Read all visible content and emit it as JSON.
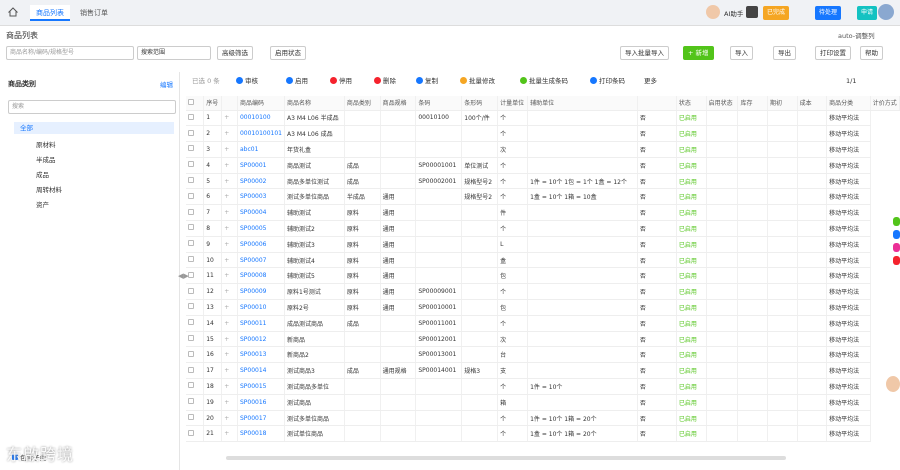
{
  "topbar": {
    "tabs": [
      "商品列表",
      "销售订单"
    ],
    "user_label": "AI助手",
    "buttons": [
      "已完成",
      "待处理",
      "申请"
    ],
    "colors": {
      "orange": "#f5a623",
      "blue": "#1677ff",
      "teal": "#13c2c2"
    }
  },
  "page": {
    "title": "商品列表",
    "right_hint": "auto-调整列"
  },
  "toolbar1": {
    "search_placeholder": "商品名称/编码/规格型号",
    "search_scope": "搜索范围",
    "filter_label": "高级筛选",
    "quick_filter": "启用状态",
    "import_label": "导入批量导入",
    "new_label": "+ 新增",
    "btn_in": "导入",
    "btn_out": "导出",
    "btn_print": "打印设置",
    "btn_more": "帮助"
  },
  "sidebar": {
    "title": "商品类别",
    "manage": "编辑",
    "search_placeholder": "搜索",
    "tree": [
      {
        "label": "全部",
        "active": true
      },
      {
        "label": "原材料"
      },
      {
        "label": "半成品"
      },
      {
        "label": "成品"
      },
      {
        "label": "周转材料"
      },
      {
        "label": "资产"
      }
    ],
    "footer_checkbox": "包含子类"
  },
  "toolbar2": {
    "selected": "已选 0 条",
    "items": [
      "审核",
      "启用",
      "停用",
      "删除",
      "复制",
      "批量修改",
      "批量生成条码",
      "打印条码",
      "更多"
    ],
    "pager": "1/1"
  },
  "table": {
    "headers": [
      "",
      "序号",
      "",
      "商品编码",
      "商品名称",
      "商品类别",
      "商品规格",
      "条码",
      "条形码",
      "计量单位",
      "辅助单位",
      "",
      "状态",
      "启用状态",
      "库存",
      "期初",
      "成本",
      "商品分类",
      "计价方式"
    ],
    "rows": [
      [
        "1",
        "00010100",
        "A3 M4 L06 半成品",
        "",
        "",
        "00010100",
        "100个/件",
        "个",
        "",
        "否",
        "已启用",
        "",
        "",
        "",
        "",
        "移动平均法"
      ],
      [
        "2",
        "00010100101",
        "A3 M4 L06 成品",
        "",
        "",
        "",
        "",
        "个",
        "",
        "否",
        "已启用",
        "",
        "",
        "",
        "",
        "移动平均法"
      ],
      [
        "3",
        "abc01",
        "年货礼盒",
        "",
        "",
        "",
        "",
        "次",
        "",
        "否",
        "已启用",
        "",
        "",
        "",
        "",
        "移动平均法"
      ],
      [
        "4",
        "SP00001",
        "商品测试",
        "成品",
        "",
        "SP00001001",
        "单位测试",
        "个",
        "",
        "否",
        "已启用",
        "",
        "",
        "",
        "",
        "移动平均法"
      ],
      [
        "5",
        "SP00002",
        "商品多单位测试",
        "成品",
        "",
        "SP00002001",
        "规格型号2",
        "个",
        "1件 = 10个 1包 = 1个 1盒 = 12个",
        "否",
        "已启用",
        "",
        "",
        "",
        "",
        "移动平均法"
      ],
      [
        "6",
        "SP00003",
        "测试多单位商品",
        "半成品",
        "通用",
        "",
        "规格型号2",
        "个",
        "1盒 = 10个 1箱 = 10盒",
        "否",
        "已启用",
        "",
        "",
        "",
        "",
        "移动平均法"
      ],
      [
        "7",
        "SP00004",
        "辅助测试",
        "原料",
        "通用",
        "",
        "",
        "件",
        "",
        "否",
        "已启用",
        "",
        "",
        "",
        "",
        "移动平均法"
      ],
      [
        "8",
        "SP00005",
        "辅助测试2",
        "原料",
        "通用",
        "",
        "",
        "个",
        "",
        "否",
        "已启用",
        "",
        "",
        "",
        "",
        "移动平均法"
      ],
      [
        "9",
        "SP00006",
        "辅助测试3",
        "原料",
        "通用",
        "",
        "",
        "L",
        "",
        "否",
        "已启用",
        "",
        "",
        "",
        "",
        "移动平均法"
      ],
      [
        "10",
        "SP00007",
        "辅助测试4",
        "原料",
        "通用",
        "",
        "",
        "盒",
        "",
        "否",
        "已启用",
        "",
        "",
        "",
        "",
        "移动平均法"
      ],
      [
        "11",
        "SP00008",
        "辅助测试5",
        "原料",
        "通用",
        "",
        "",
        "包",
        "",
        "否",
        "已启用",
        "",
        "",
        "",
        "",
        "移动平均法"
      ],
      [
        "12",
        "SP00009",
        "原料1号测试",
        "原料",
        "通用",
        "SP00009001",
        "",
        "个",
        "",
        "否",
        "已启用",
        "",
        "",
        "",
        "",
        "移动平均法"
      ],
      [
        "13",
        "SP00010",
        "原料2号",
        "原料",
        "通用",
        "SP00010001",
        "",
        "包",
        "",
        "否",
        "已启用",
        "",
        "",
        "",
        "",
        "移动平均法"
      ],
      [
        "14",
        "SP00011",
        "成品测试商品",
        "成品",
        "",
        "SP00011001",
        "",
        "个",
        "",
        "否",
        "已启用",
        "",
        "",
        "",
        "",
        "移动平均法"
      ],
      [
        "15",
        "SP00012",
        "新商品",
        "",
        "",
        "SP00012001",
        "",
        "次",
        "",
        "否",
        "已启用",
        "",
        "",
        "",
        "",
        "移动平均法"
      ],
      [
        "16",
        "SP00013",
        "新商品2",
        "",
        "",
        "SP00013001",
        "",
        "台",
        "",
        "否",
        "已启用",
        "",
        "",
        "",
        "",
        "移动平均法"
      ],
      [
        "17",
        "SP00014",
        "测试商品3",
        "成品",
        "通用规格",
        "SP00014001",
        "规格3",
        "支",
        "",
        "否",
        "已启用",
        "",
        "",
        "",
        "",
        "移动平均法"
      ],
      [
        "18",
        "SP00015",
        "测试商品多单位",
        "",
        "",
        "",
        "",
        "个",
        "1件 = 10个",
        "否",
        "已启用",
        "",
        "",
        "",
        "",
        "移动平均法"
      ],
      [
        "19",
        "SP00016",
        "测试商品",
        "",
        "",
        "",
        "",
        "箱",
        "",
        "否",
        "已启用",
        "",
        "",
        "",
        "",
        "移动平均法"
      ],
      [
        "20",
        "SP00017",
        "测试多单位商品",
        "",
        "",
        "",
        "",
        "个",
        "1件 = 10个 1箱 = 20个",
        "否",
        "已启用",
        "",
        "",
        "",
        "",
        "移动平均法"
      ],
      [
        "21",
        "SP00018",
        "测试单位商品",
        "",
        "",
        "",
        "",
        "个",
        "1盒 = 10个 1箱 = 20个",
        "否",
        "已启用",
        "",
        "",
        "",
        "",
        "移动平均法"
      ]
    ]
  },
  "watermark": "东啟跨境"
}
